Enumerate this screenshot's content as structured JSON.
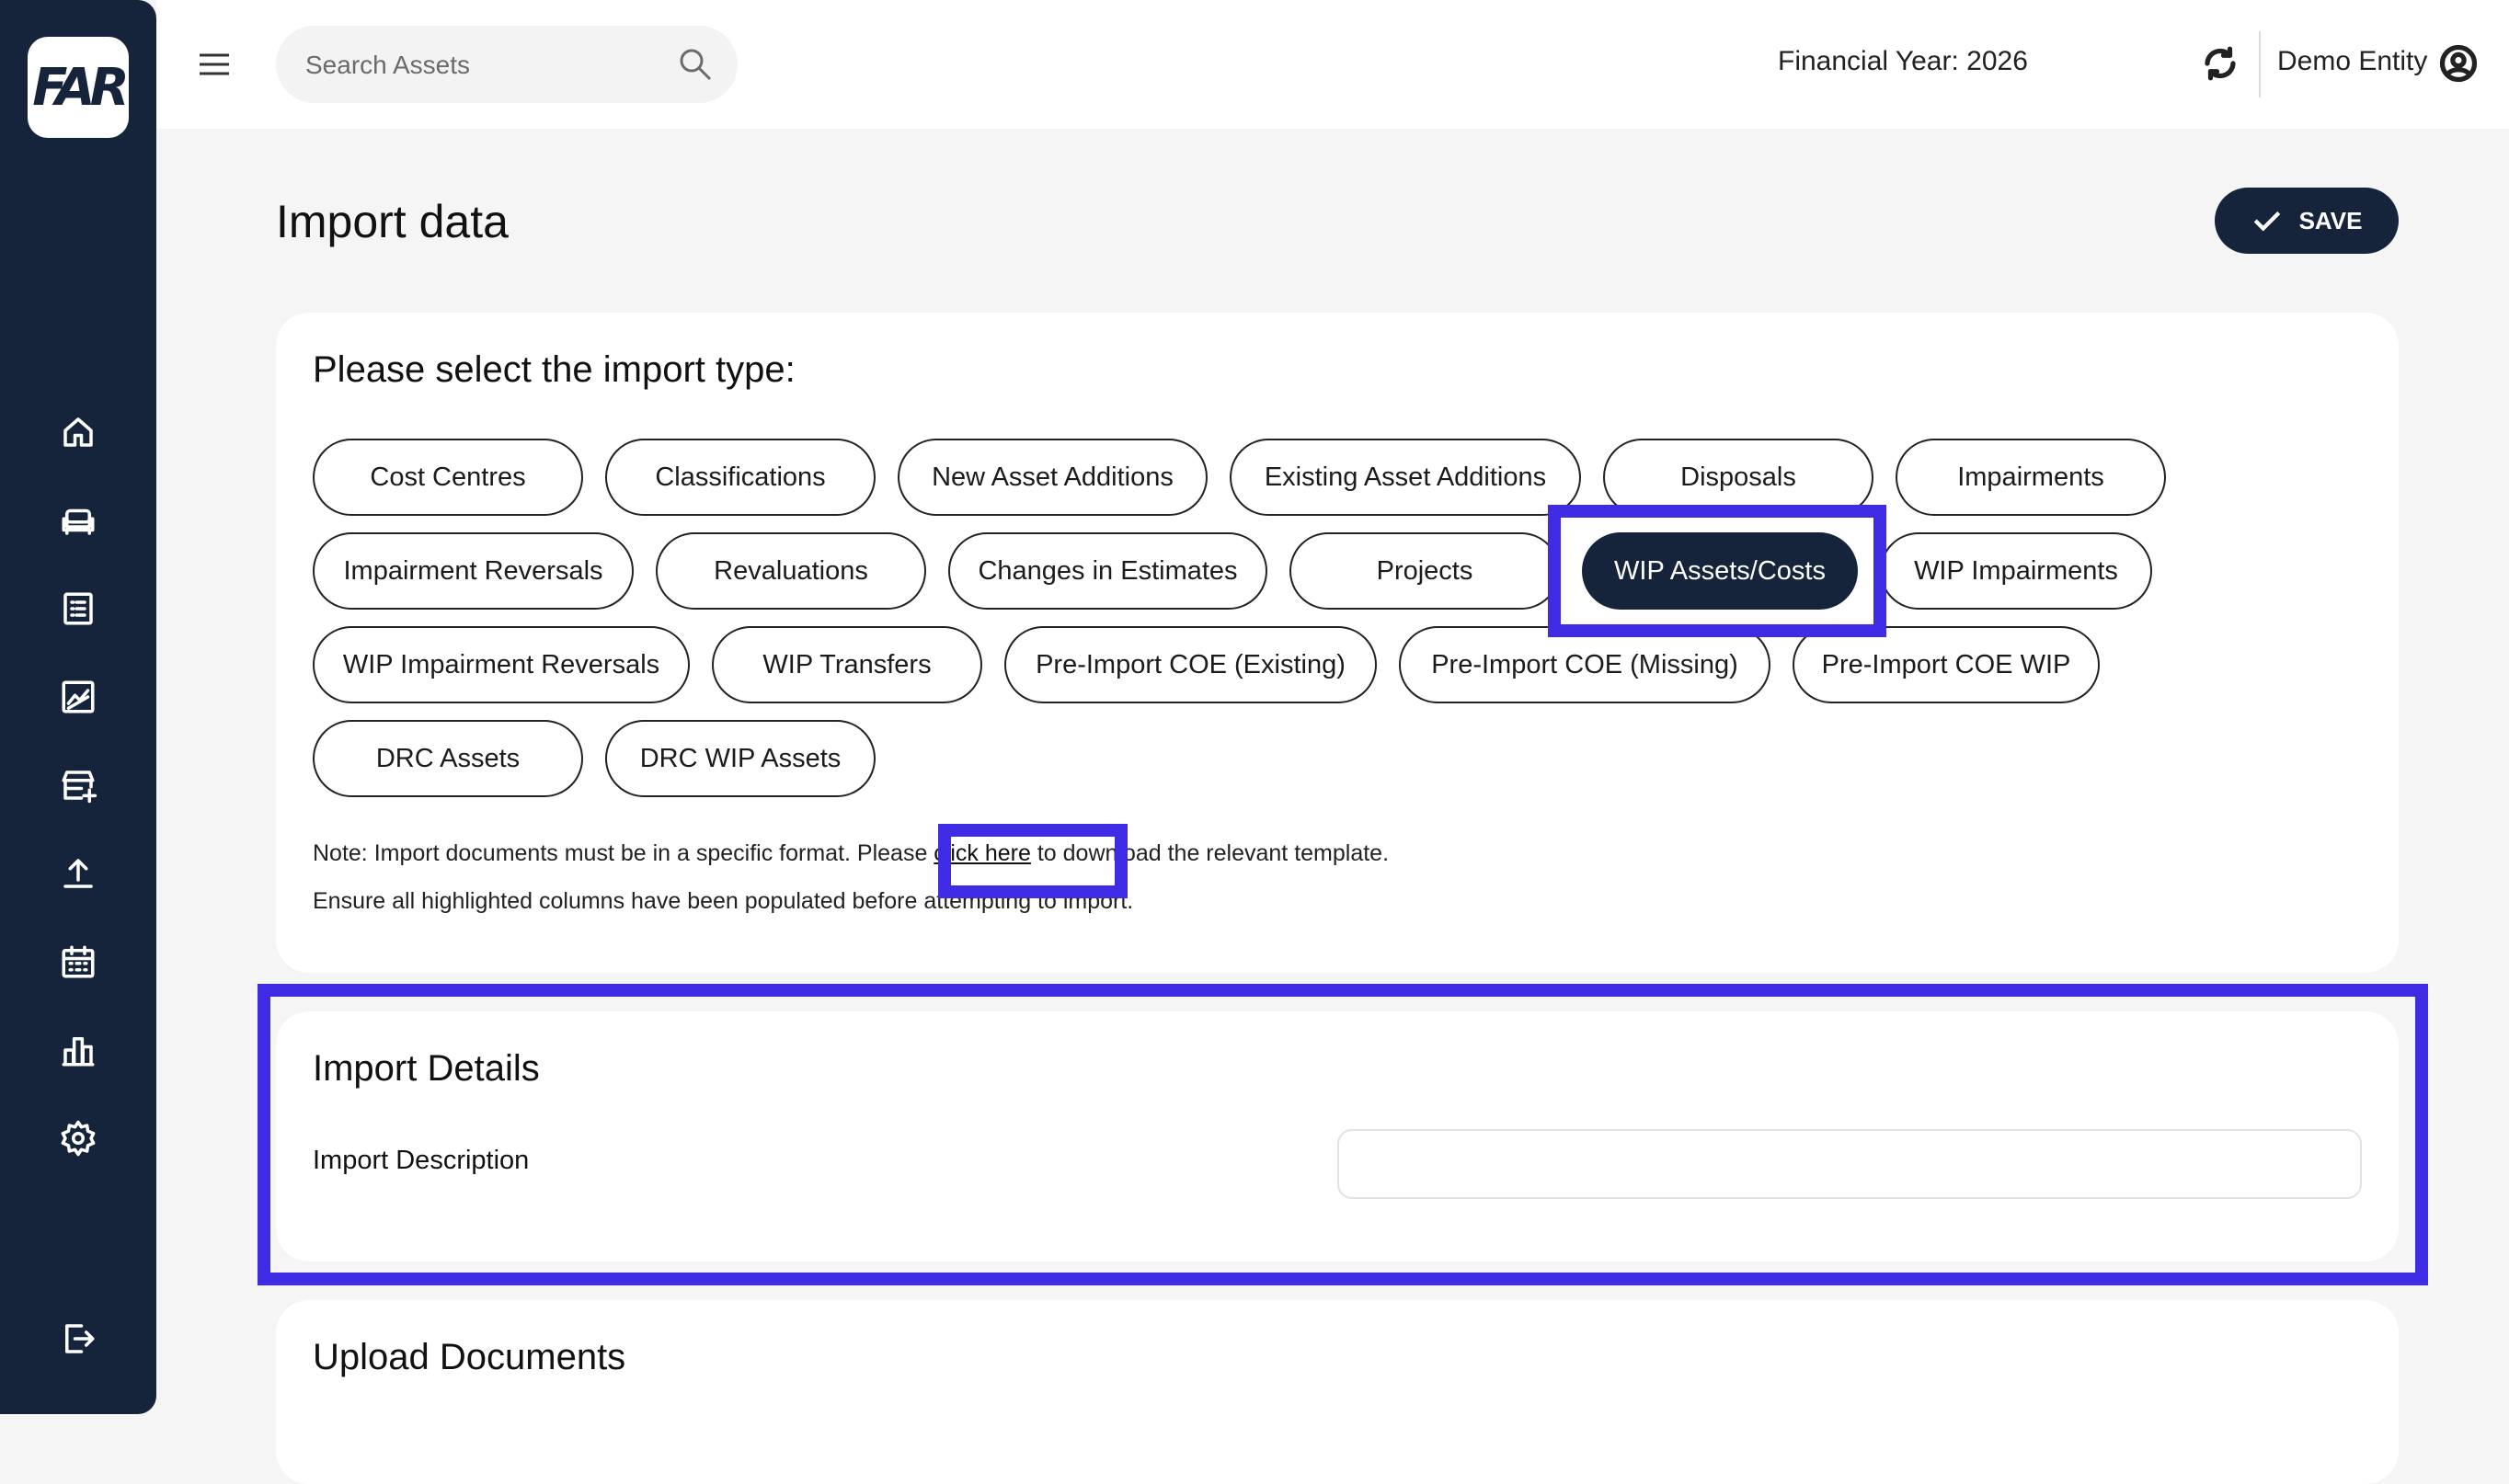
{
  "brand": {
    "logo_text": "FAR"
  },
  "header": {
    "search_placeholder": "Search Assets",
    "financial_year": "Financial Year: 2026",
    "entity": "Demo Entity"
  },
  "page": {
    "title": "Import data",
    "save_label": "SAVE"
  },
  "import_type": {
    "heading": "Please select the import type:",
    "options": [
      "Cost Centres",
      "Classifications",
      "New Asset Additions",
      "Existing Asset Additions",
      "Disposals",
      "Impairments",
      "Impairment Reversals",
      "Revaluations",
      "Changes in Estimates",
      "Projects",
      "WIP Assets/Costs",
      "WIP Impairments",
      "WIP Impairment Reversals",
      "WIP Transfers",
      "Pre-Import COE (Existing)",
      "Pre-Import COE (Missing)",
      "Pre-Import COE WIP",
      "DRC Assets",
      "DRC WIP Assets"
    ],
    "selected": "WIP Assets/Costs",
    "note_prefix": "Note: Import documents must be in a specific format. Please ",
    "note_link": "click here",
    "note_suffix": " to download the relevant template.",
    "note_line2": "Ensure all highlighted columns have been populated before attempting to import."
  },
  "import_details": {
    "heading": "Import Details",
    "description_label": "Import Description",
    "description_value": ""
  },
  "upload": {
    "heading": "Upload Documents"
  },
  "sidebar": {
    "icons": [
      "home-icon",
      "sofa-icon",
      "list-icon",
      "chart-line-icon",
      "store-add-icon",
      "upload-icon",
      "calendar-icon",
      "bar-chart-icon",
      "gear-icon",
      "logout-icon"
    ]
  },
  "colors": {
    "navy": "#16243b",
    "highlight": "#3e2be3"
  }
}
